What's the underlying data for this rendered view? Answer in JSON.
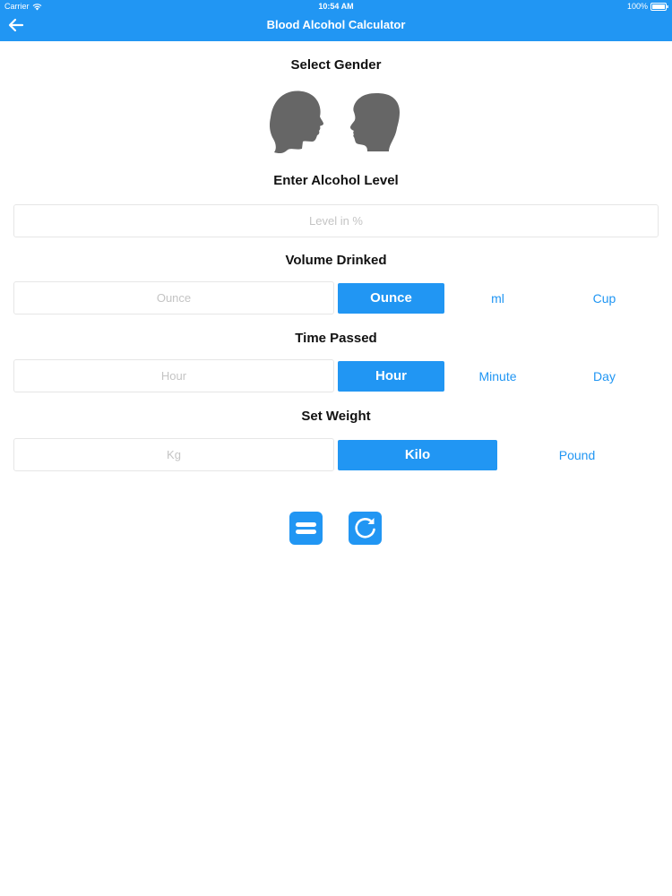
{
  "status_bar": {
    "carrier": "Carrier",
    "time": "10:54 AM",
    "battery": "100%"
  },
  "nav": {
    "title": "Blood Alcohol Calculator",
    "back_icon": "arrow-left-icon"
  },
  "gender": {
    "title": "Select Gender",
    "options": [
      "female-silhouette-icon",
      "male-silhouette-icon"
    ]
  },
  "alcohol": {
    "title": "Enter Alcohol Level",
    "placeholder": "Level in %"
  },
  "volume": {
    "title": "Volume Drinked",
    "placeholder": "Ounce",
    "units": [
      "Ounce",
      "ml",
      "Cup"
    ],
    "selected": "Ounce"
  },
  "time": {
    "title": "Time Passed",
    "placeholder": "Hour",
    "units": [
      "Hour",
      "Minute",
      "Day"
    ],
    "selected": "Hour"
  },
  "weight": {
    "title": "Set Weight",
    "placeholder": "Kg",
    "units": [
      "Kilo",
      "Pound"
    ],
    "selected": "Kilo"
  },
  "actions": {
    "calculate_icon": "equals-icon",
    "reset_icon": "refresh-icon"
  },
  "colors": {
    "accent": "#2196F3",
    "silhouette": "#666666"
  }
}
